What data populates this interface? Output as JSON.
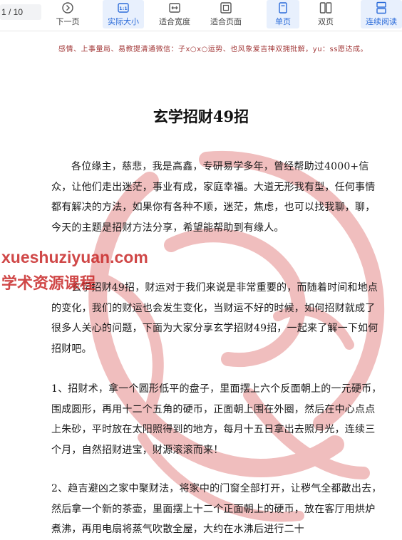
{
  "toolbar": {
    "page_indicator": "1  / 10",
    "buttons": [
      {
        "label": "下一页",
        "icon": "next-page-icon"
      },
      {
        "label": "实际大小",
        "icon": "actual-size-icon",
        "active": true
      },
      {
        "label": "适合宽度",
        "icon": "fit-width-icon"
      },
      {
        "label": "适合页面",
        "icon": "fit-page-icon"
      },
      {
        "label": "单页",
        "icon": "single-page-icon",
        "active": true
      },
      {
        "label": "双页",
        "icon": "double-page-icon"
      },
      {
        "label": "连续阅读",
        "icon": "continuous-read-icon",
        "active": true
      }
    ]
  },
  "document": {
    "header_note": "感情、上事量局、易教提清通微信：子x○x○运势、也风象爱吉神双拥批解，yu：ss愿达成。",
    "title": "玄学招财49招",
    "paragraphs": [
      "各位缘主，慈悲，我是高鑫，专研易学多年，曾经帮助过4000+信众，让他们走出迷茫，事业有成，家庭幸福。大道无形我有型，任何事情都有解决的方法，如果你有各种不顺，迷茫，焦虑，也可以找我聊，聊，今天的主题是招财方法分享，希望能帮助到有缘人。",
      "玄学招财49招，财运对于我们来说是非常重要的，而随着时间和地点的变化，我们的财运也会发生变化，当财运不好的时候，如何招财就成了很多人关心的问题，下面为大家分享玄学招财49招，一起来了解一下如何招财吧。",
      "1、招财术，拿一个圆形低平的盘子，里面摆上六个反面朝上的一元硬币，围成圆形，再用十二个五角的硬币，正面朝上围在外圈，然后在中心点点上朱砂，平时放在太阳照得到的地方，每月十五日拿出去照月光，连续三个月，自然招财进宝，财源滚滚而来！",
      "2、趋吉避凶之家中聚财法，将家中的门窗全部打开，让秽气全都散出去，然后拿一个新的茶壶，里面摆上十二个正面朝上的硬币，放在客厅用烘炉煮沸，再用电扇将蒸气吹散全屋，大约在水沸后进行二十"
    ]
  },
  "watermark": {
    "line1": "xueshuziyuan.com",
    "line2": "学术资源课程"
  },
  "colors": {
    "accent": "#2b6bd9",
    "active_bg": "#e8f0fd",
    "watermark": "#c82828",
    "seal": "#e58a8a"
  }
}
